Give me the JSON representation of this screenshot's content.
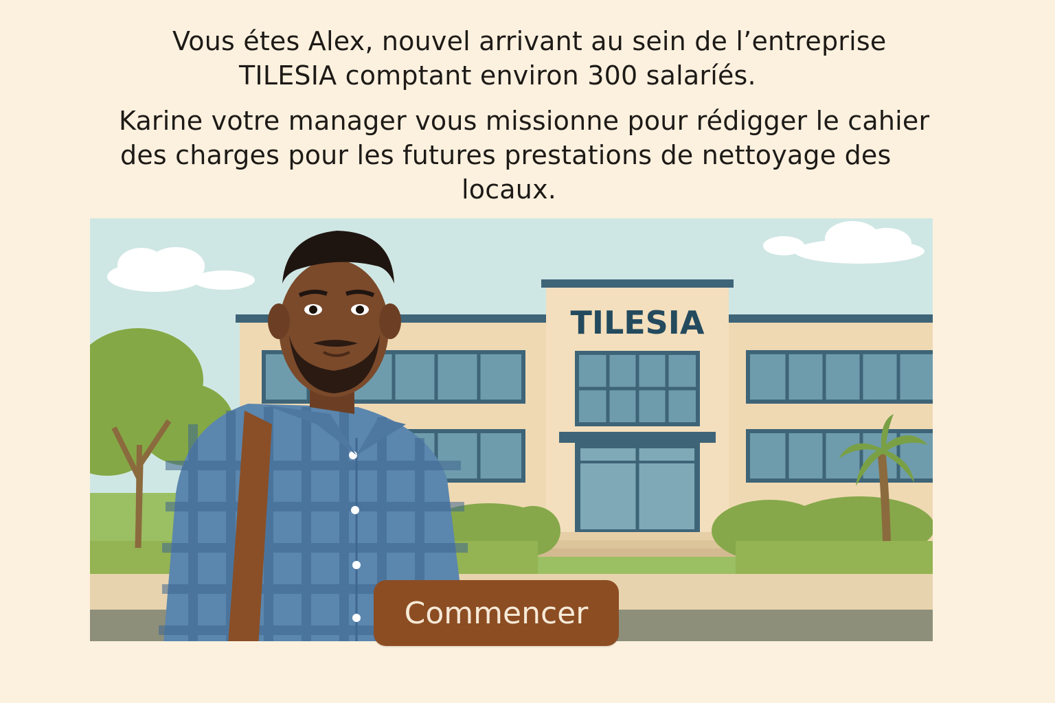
{
  "intro": {
    "paragraph1": [
      "Vous étes Alex, nouvel arrivant au sein de l’entreprise",
      "TILESIA comptant environ 300 salaríés."
    ],
    "paragraph2": [
      "Karine votre manager vous missionne pour rédigger le cahier",
      "des charges pour les futures prestations de nettoyage des",
      "locaux."
    ]
  },
  "scene": {
    "building_sign": "TILESIA",
    "colors": {
      "sky": "#cfe7e4",
      "building": "#efd9b3",
      "building_trim": "#3e6478",
      "window": "#6e9cac",
      "sign_text": "#244a5e",
      "foliage": "#86a84a",
      "shirt": "#5b86ae",
      "skin": "#7b4a2b",
      "strap": "#8a4f26"
    }
  },
  "start_button": {
    "label": "Commencer",
    "color": "#8c4d23"
  }
}
